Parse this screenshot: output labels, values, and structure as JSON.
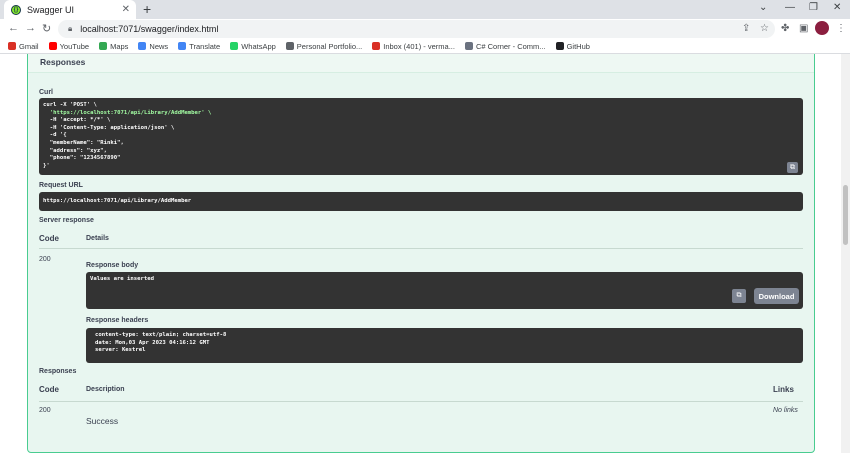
{
  "browser": {
    "tab_title": "Swagger UI",
    "tab_favicon": "swagger-icon",
    "url": "localhost:7071/swagger/index.html",
    "bookmarks": [
      {
        "label": "Gmail",
        "icon": "gmail-icon",
        "color": "#d93025"
      },
      {
        "label": "YouTube",
        "icon": "youtube-icon",
        "color": "#ff0000"
      },
      {
        "label": "Maps",
        "icon": "maps-icon",
        "color": "#34a853"
      },
      {
        "label": "News",
        "icon": "news-icon",
        "color": "#4285f4"
      },
      {
        "label": "Translate",
        "icon": "translate-icon",
        "color": "#4285f4"
      },
      {
        "label": "WhatsApp",
        "icon": "whatsapp-icon",
        "color": "#25d366"
      },
      {
        "label": "Personal Portfolio...",
        "icon": "globe-icon",
        "color": "#5f6368"
      },
      {
        "label": "Inbox (401) - verma...",
        "icon": "gmail-icon",
        "color": "#d93025"
      },
      {
        "label": "C# Corner - Comm...",
        "icon": "csharp-corner-icon",
        "color": "#6b7280"
      },
      {
        "label": "GitHub",
        "icon": "github-icon",
        "color": "#202124"
      }
    ]
  },
  "swagger": {
    "responses_title": "Responses",
    "curl_label": "Curl",
    "curl_lines": [
      {
        "text": "curl -X 'POST' \\",
        "cls": ""
      },
      {
        "text": "  'https://localhost:7071/api/Library/AddMember' \\",
        "cls": "str"
      },
      {
        "text": "  -H 'accept: */*' \\",
        "cls": ""
      },
      {
        "text": "  -H 'Content-Type: application/json' \\",
        "cls": ""
      },
      {
        "text": "  -d '{",
        "cls": ""
      },
      {
        "text": "  \"memberName\": \"Rinki\",",
        "cls": ""
      },
      {
        "text": "  \"address\": \"xyz\",",
        "cls": ""
      },
      {
        "text": "  \"phone\": \"1234567890\"",
        "cls": ""
      },
      {
        "text": "}'",
        "cls": ""
      }
    ],
    "request_url_label": "Request URL",
    "request_url": "https://localhost:7071/api/Library/AddMember",
    "server_response_label": "Server response",
    "code_header": "Code",
    "details_header": "Details",
    "server_code": "200",
    "response_body_label": "Response body",
    "response_body": "Values are inserted",
    "download_label": "Download",
    "response_headers_label": "Response headers",
    "response_headers": [
      "content-type: text/plain; charset=utf-8",
      "date: Mon,03 Apr 2023 04:16:12 GMT",
      "server: Kestrel"
    ],
    "responses_label": "Responses",
    "table_code_header": "Code",
    "description_header": "Description",
    "links_header": "Links",
    "doc_code": "200",
    "doc_description": "Success",
    "doc_links": "No links"
  }
}
